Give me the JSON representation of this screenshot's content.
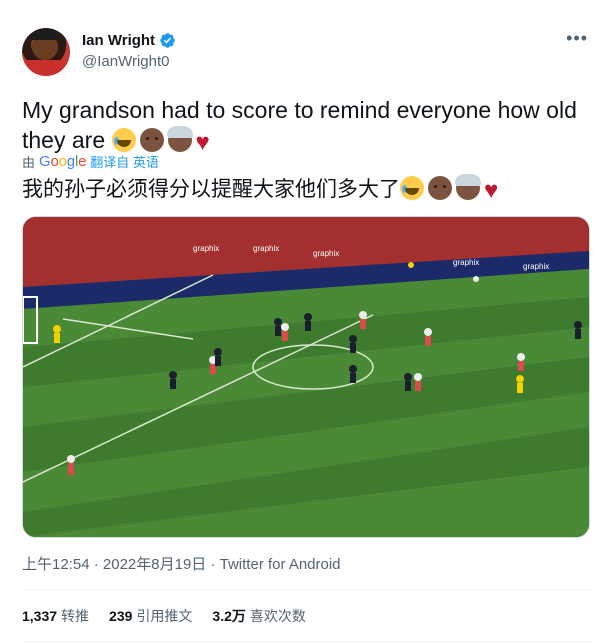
{
  "author": {
    "display_name": "Ian Wright",
    "handle": "@IanWright0",
    "verified": true,
    "avatar_icon": "avatar-photo"
  },
  "more_icon": "more-horizontal-icon",
  "tweet": {
    "text_en_line1": "My grandson had to score to remind everyone how old",
    "text_en_line2": "they are",
    "emojis": [
      "face-with-tears-of-joy",
      "man-medium-dark-skin",
      "older-woman-medium-dark-skin",
      "red-heart"
    ],
    "translated_by_prefix": "由",
    "translated_by_brand": "Google",
    "translated_by_action": "翻译自 英语",
    "text_zh": "我的孙子必须得分以提醒大家他们多大了"
  },
  "media": {
    "type": "video-frame",
    "board_ads": [
      "graphix",
      "graphix",
      "graphix",
      "graphix",
      "graphix",
      "graphix"
    ]
  },
  "meta": {
    "time": "上午12:54",
    "separator": "·",
    "date": "2022年8月19日",
    "source": "Twitter for Android"
  },
  "stats": {
    "retweets_count": "1,337",
    "retweets_label": "转推",
    "quotes_count": "239",
    "quotes_label": "引用推文",
    "likes_count": "3.2万",
    "likes_label": "喜欢次数"
  },
  "colors": {
    "verified_blue": "#1d9bf0",
    "heart_red": "#be1931",
    "secondary_text": "#536471",
    "pitch_green": "#3f7b2f"
  }
}
